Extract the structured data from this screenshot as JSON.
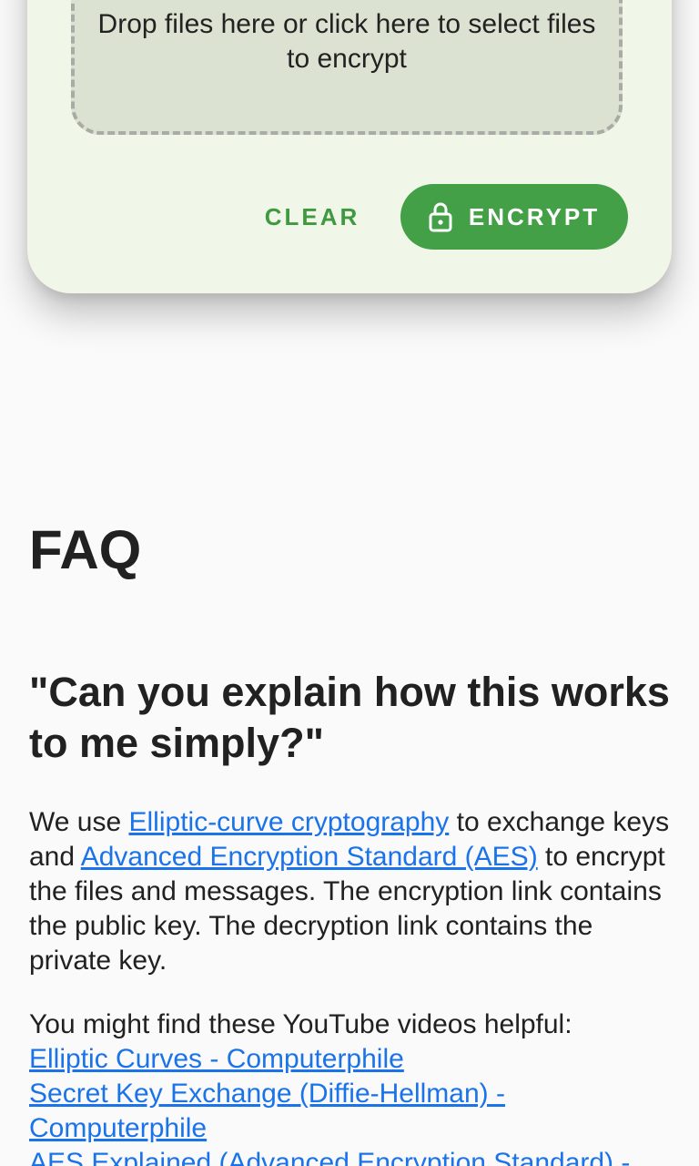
{
  "dropzone": {
    "text": "Drop files here or click here to select files to encrypt"
  },
  "actions": {
    "clear_label": "CLEAR",
    "encrypt_label": "ENCRYPT",
    "encrypt_icon": "lock-icon"
  },
  "faq": {
    "title": "FAQ",
    "question": "\"Can you explain how this works to me simply?\"",
    "answer": {
      "part1": "We use ",
      "link1": "Elliptic-curve cryptography",
      "part2": " to exchange keys and ",
      "link2": "Advanced Encryption Standard (AES)",
      "part3": " to encrypt the files and messages. The encryption link contains the public key. The decryption link contains the private key."
    },
    "videos_intro": "You might find these YouTube videos helpful:",
    "videos": [
      "Elliptic Curves - Computerphile",
      "Secret Key Exchange (Diffie-Hellman) - Computerphile",
      "AES Explained (Advanced Encryption Standard) - Computerphile"
    ]
  },
  "colors": {
    "accent": "#43a047",
    "link": "#1a73e8",
    "card_bg": "#f1f7e8",
    "dropzone_bg": "#dbe2d1"
  }
}
